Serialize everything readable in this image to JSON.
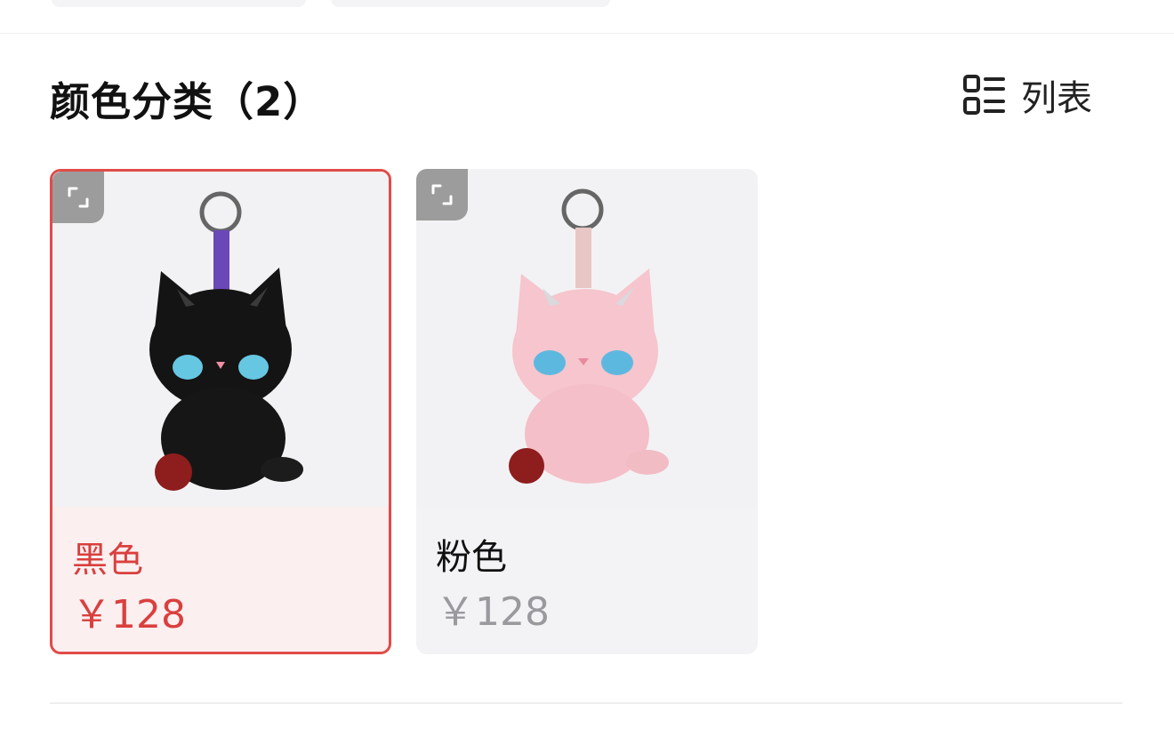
{
  "section": {
    "title": "颜色分类（2）",
    "view_toggle_label": "列表",
    "view_toggle_icon": "list-view-icon"
  },
  "colors": {
    "accent": "#e14b49",
    "selected_bg": "#fbeff0",
    "card_bg": "#f3f3f6",
    "muted_price": "#9a9a9e"
  },
  "variants": [
    {
      "name": "黑色",
      "price": "￥128",
      "selected": true,
      "image": "black-plush-cat-keychain"
    },
    {
      "name": "粉色",
      "price": "￥128",
      "selected": false,
      "image": "pink-plush-cat-keychain"
    }
  ]
}
